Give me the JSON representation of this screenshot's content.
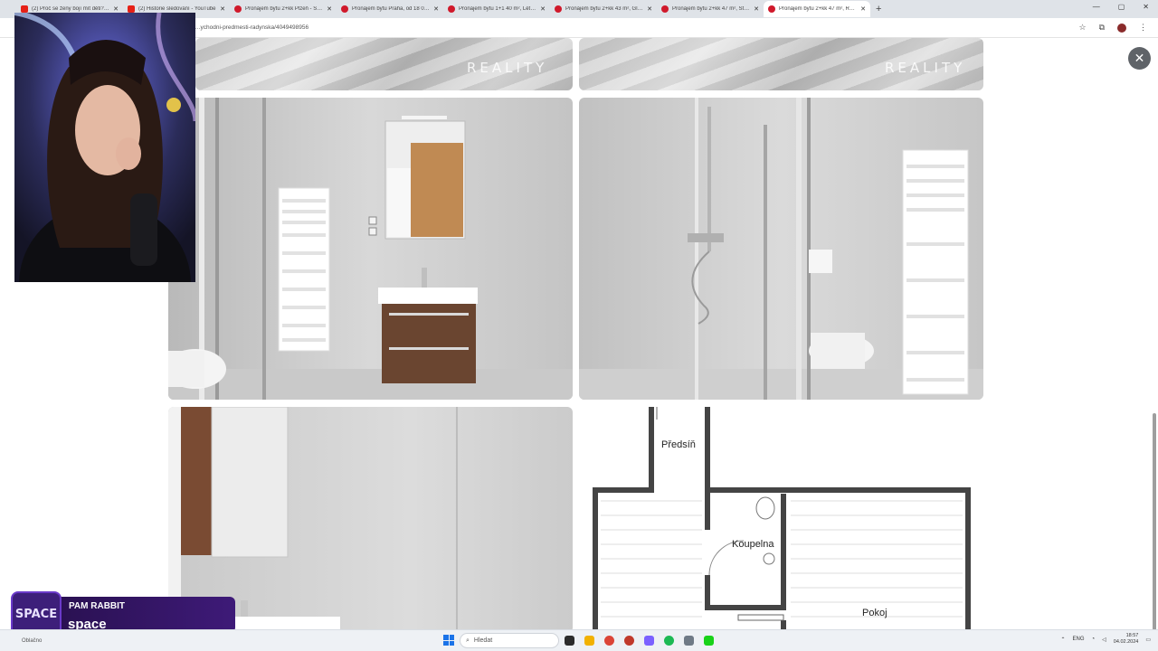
{
  "browser": {
    "tabs": [
      {
        "title": "(2) Proč se ženy bojí mít děti? I…",
        "favicon": "youtube-icon"
      },
      {
        "title": "(2) Historie sledování - YouTube",
        "favicon": "youtube-icon"
      },
      {
        "title": "Pronájem bytu 2+kk Plzeň - Sv…",
        "favicon": "sreality-icon"
      },
      {
        "title": "Pronájem bytu Praha, od 18 00…",
        "favicon": "sreality-icon"
      },
      {
        "title": "Pronájem bytu 1+1 40 m², Léta…",
        "favicon": "sreality-icon"
      },
      {
        "title": "Pronájem bytu 2+kk 43 m², Gl…",
        "favicon": "sreality-icon"
      },
      {
        "title": "Pronájem bytu 2+kk 47 m², Ští…",
        "favicon": "sreality-icon"
      },
      {
        "title": "Pronájem bytu 2+kk 47 m², Ra…",
        "favicon": "sreality-icon"
      }
    ],
    "active_tab_index": 7,
    "new_tab_label": "+",
    "url": "…ychodni-predmesti-radynska/4049498956"
  },
  "gallery": {
    "watermark_top": "REALITY",
    "watermark_logo": "coca",
    "close_label": "✕",
    "floorplan_labels": {
      "hall": "Předsíň",
      "bathroom": "Koupelna",
      "room": "Pokoj"
    }
  },
  "streamer": {
    "logo_text": "SPACE",
    "name": "PAM RABBIT",
    "subtitle": "space"
  },
  "taskbar": {
    "weather": "Oblačno",
    "search_placeholder": "Hledat",
    "lang": "ENG",
    "time": "18:57",
    "date": "04.02.2024"
  }
}
